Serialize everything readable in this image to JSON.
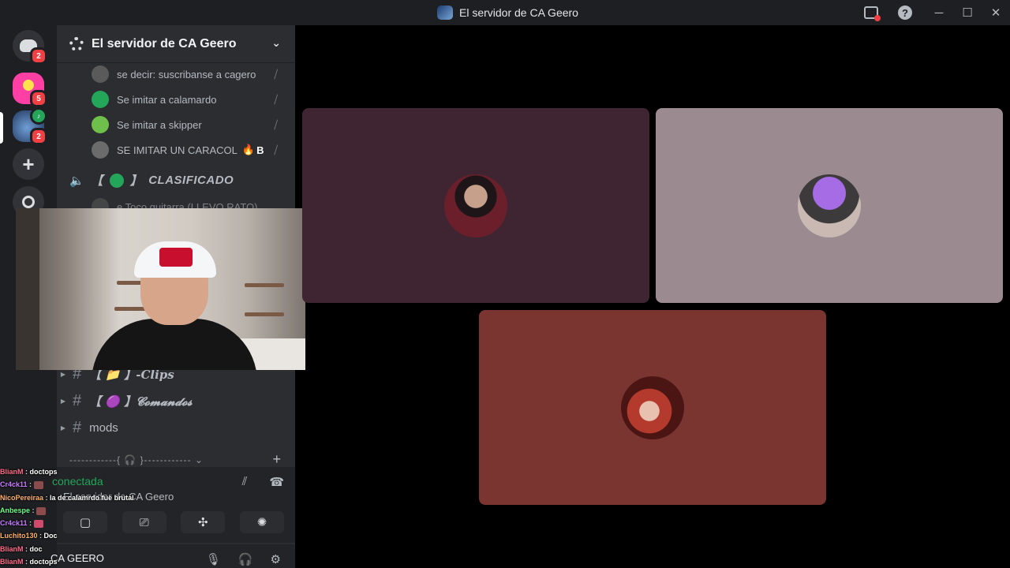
{
  "window": {
    "title": "El servidor de CA Geero"
  },
  "guilds": {
    "home_badge": "2",
    "server1_badge": "5",
    "server2_badge": "2",
    "add_label": "+"
  },
  "sidebar": {
    "server_name": "El servidor de CA Geero",
    "voice_users": [
      {
        "name": "se decir: suscribanse a cagero",
        "avatar_color": "#5a5a5a"
      },
      {
        "name": "Se imitar a calamardo",
        "avatar_color": "#23a55a"
      },
      {
        "name": "Se imitar a skipper",
        "avatar_color": "#6fbf4b"
      },
      {
        "name": "SE IMITAR UN CARACOL",
        "avatar_color": "#6b6b6b",
        "tag": "B"
      }
    ],
    "voice_channel": {
      "prefix": "【",
      "suffix": "】",
      "name": "CLASIFICADO"
    },
    "hidden_user": "e Toco guitarra (LLEVO RATO)",
    "text_channels": [
      {
        "label": "【 📁 】-Clips"
      },
      {
        "label": "【 🟣 】𝓒𝓸𝓶𝓪𝓷𝓭𝓸𝓼"
      },
      {
        "label": "mods"
      }
    ],
    "category_separator": "------------{ 🎧 }------------ ⌄"
  },
  "voice_panel": {
    "status": "conectada",
    "server": "El servidor de CA Geero",
    "server_partial": "dor de CA Geero"
  },
  "user_panel": {
    "name": "CA GEERO"
  },
  "chat": [
    {
      "user": "BlianM",
      "color": "#ff6b8a",
      "text": "doctops"
    },
    {
      "user": "Cr4ck11",
      "color": "#c77dff",
      "text": ""
    },
    {
      "user": "NicoPereiraa",
      "color": "#ffb36b",
      "text": "la de calamrdo fue brutal"
    },
    {
      "user": "Anbespe",
      "color": "#6bff8a",
      "text": ""
    },
    {
      "user": "Cr4ck11",
      "color": "#c77dff",
      "text": ""
    },
    {
      "user": "Luchito130",
      "color": "#ffb36b",
      "text": "Doc"
    },
    {
      "user": "BlianM",
      "color": "#ff6b8a",
      "text": "doc"
    },
    {
      "user": "BlianM",
      "color": "#ff6b8a",
      "text": "doctops"
    }
  ],
  "tiles": [
    {
      "bg": "#3f2532"
    },
    {
      "bg": "#9b8b91"
    },
    {
      "bg": "#7b3530"
    }
  ]
}
